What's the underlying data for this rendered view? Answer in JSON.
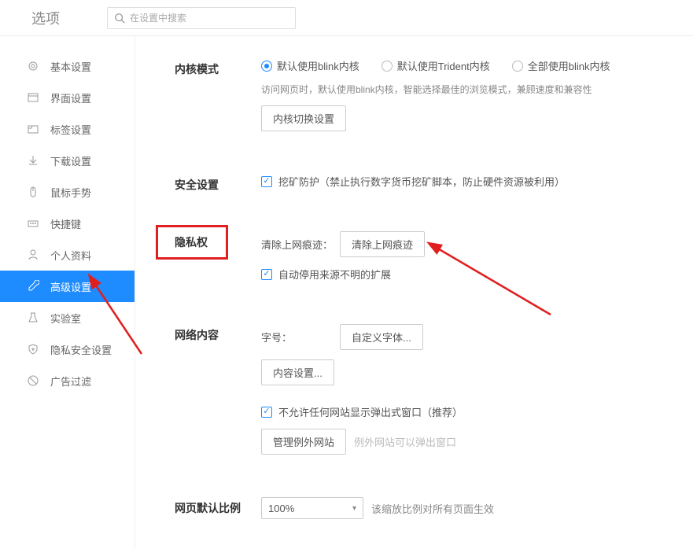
{
  "header": {
    "title": "选项",
    "search_placeholder": "在设置中搜索"
  },
  "sidebar": {
    "items": [
      {
        "label": "基本设置"
      },
      {
        "label": "界面设置"
      },
      {
        "label": "标签设置"
      },
      {
        "label": "下载设置"
      },
      {
        "label": "鼠标手势"
      },
      {
        "label": "快捷键"
      },
      {
        "label": "个人资料"
      },
      {
        "label": "高级设置"
      },
      {
        "label": "实验室"
      },
      {
        "label": "隐私安全设置"
      },
      {
        "label": "广告过滤"
      }
    ]
  },
  "sections": {
    "kernel": {
      "label": "内核模式",
      "radios": [
        "默认使用blink内核",
        "默认使用Trident内核",
        "全部使用blink内核"
      ],
      "desc": "访问网页时，默认使用blink内核，智能选择最佳的浏览模式，兼顾速度和兼容性",
      "btn": "内核切换设置"
    },
    "security": {
      "label": "安全设置",
      "mining": "挖矿防护（禁止执行数字货币挖矿脚本，防止硬件资源被利用）"
    },
    "privacy": {
      "label": "隐私权",
      "clear_label": "清除上网痕迹：",
      "clear_btn": "清除上网痕迹",
      "auto_disable": "自动停用来源不明的扩展"
    },
    "webcontent": {
      "label": "网络内容",
      "font_label": "字号：",
      "font_btn": "自定义字体...",
      "content_btn": "内容设置...",
      "popup_check": "不允许任何网站显示弹出式窗口（推荐）",
      "manage_btn": "管理例外网站",
      "manage_hint": "例外网站可以弹出窗口"
    },
    "zoom": {
      "label": "网页默认比例",
      "value": "100%",
      "hint": "该缩放比例对所有页面生效"
    }
  }
}
